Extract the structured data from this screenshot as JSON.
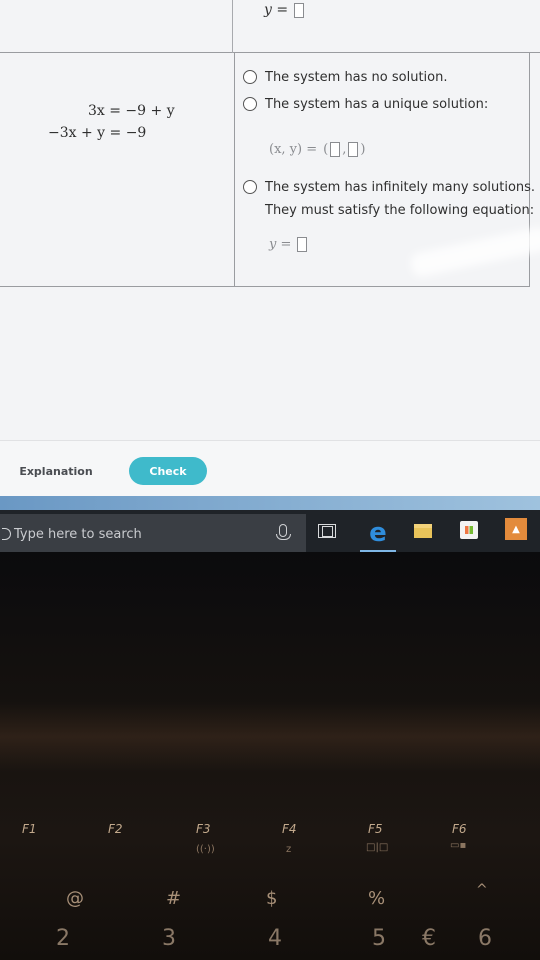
{
  "previous_row": {
    "equation_label": "y ="
  },
  "problem": {
    "equations": [
      "3x = −9 + y",
      "−3x + y = −9"
    ],
    "options": {
      "no_solution": "The system has no solution.",
      "unique": "The system has a unique solution:",
      "unique_answer_label": "(x, y) =",
      "infinite_line1": "The system has infinitely many solutions.",
      "infinite_line2": "They must satisfy the following equation:",
      "infinite_answer_label": "y ="
    }
  },
  "footer": {
    "explanation_label": "Explanation",
    "check_label": "Check"
  },
  "taskbar": {
    "search_placeholder": "Type here to search",
    "edge_glyph": "e"
  },
  "keyboard": {
    "function_keys": [
      "F1",
      "F2",
      "F3",
      "F4",
      "F5",
      "F6"
    ],
    "symbols": [
      "@",
      "#",
      "$",
      "%",
      "^"
    ],
    "numbers": [
      "2",
      "3",
      "4",
      "5",
      "6"
    ],
    "euro": "€"
  },
  "colors": {
    "check_button": "#3fbacb",
    "taskbar": "#1f2328",
    "edge_blue": "#2f8ddc"
  }
}
